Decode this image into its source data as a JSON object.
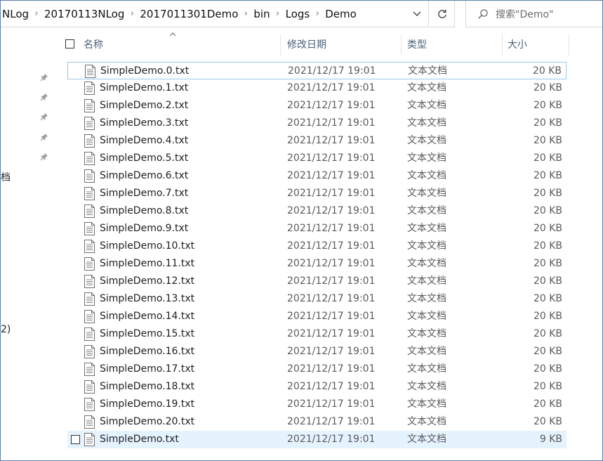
{
  "address": {
    "crumbs": [
      "NLog",
      "20170113NLog",
      "2017011301Demo",
      "bin",
      "Logs",
      "Demo"
    ]
  },
  "search": {
    "placeholder": "搜索\"Demo\""
  },
  "nav": {
    "fragments": [
      "档",
      "2)"
    ]
  },
  "columns": {
    "name": "名称",
    "date": "修改日期",
    "type": "类型",
    "size": "大小"
  },
  "files": [
    {
      "name": "SimpleDemo.0.txt",
      "date": "2021/12/17 19:01",
      "type": "文本文档",
      "size": "20 KB"
    },
    {
      "name": "SimpleDemo.1.txt",
      "date": "2021/12/17 19:01",
      "type": "文本文档",
      "size": "20 KB"
    },
    {
      "name": "SimpleDemo.2.txt",
      "date": "2021/12/17 19:01",
      "type": "文本文档",
      "size": "20 KB"
    },
    {
      "name": "SimpleDemo.3.txt",
      "date": "2021/12/17 19:01",
      "type": "文本文档",
      "size": "20 KB"
    },
    {
      "name": "SimpleDemo.4.txt",
      "date": "2021/12/17 19:01",
      "type": "文本文档",
      "size": "20 KB"
    },
    {
      "name": "SimpleDemo.5.txt",
      "date": "2021/12/17 19:01",
      "type": "文本文档",
      "size": "20 KB"
    },
    {
      "name": "SimpleDemo.6.txt",
      "date": "2021/12/17 19:01",
      "type": "文本文档",
      "size": "20 KB"
    },
    {
      "name": "SimpleDemo.7.txt",
      "date": "2021/12/17 19:01",
      "type": "文本文档",
      "size": "20 KB"
    },
    {
      "name": "SimpleDemo.8.txt",
      "date": "2021/12/17 19:01",
      "type": "文本文档",
      "size": "20 KB"
    },
    {
      "name": "SimpleDemo.9.txt",
      "date": "2021/12/17 19:01",
      "type": "文本文档",
      "size": "20 KB"
    },
    {
      "name": "SimpleDemo.10.txt",
      "date": "2021/12/17 19:01",
      "type": "文本文档",
      "size": "20 KB"
    },
    {
      "name": "SimpleDemo.11.txt",
      "date": "2021/12/17 19:01",
      "type": "文本文档",
      "size": "20 KB"
    },
    {
      "name": "SimpleDemo.12.txt",
      "date": "2021/12/17 19:01",
      "type": "文本文档",
      "size": "20 KB"
    },
    {
      "name": "SimpleDemo.13.txt",
      "date": "2021/12/17 19:01",
      "type": "文本文档",
      "size": "20 KB"
    },
    {
      "name": "SimpleDemo.14.txt",
      "date": "2021/12/17 19:01",
      "type": "文本文档",
      "size": "20 KB"
    },
    {
      "name": "SimpleDemo.15.txt",
      "date": "2021/12/17 19:01",
      "type": "文本文档",
      "size": "20 KB"
    },
    {
      "name": "SimpleDemo.16.txt",
      "date": "2021/12/17 19:01",
      "type": "文本文档",
      "size": "20 KB"
    },
    {
      "name": "SimpleDemo.17.txt",
      "date": "2021/12/17 19:01",
      "type": "文本文档",
      "size": "20 KB"
    },
    {
      "name": "SimpleDemo.18.txt",
      "date": "2021/12/17 19:01",
      "type": "文本文档",
      "size": "20 KB"
    },
    {
      "name": "SimpleDemo.19.txt",
      "date": "2021/12/17 19:01",
      "type": "文本文档",
      "size": "20 KB"
    },
    {
      "name": "SimpleDemo.20.txt",
      "date": "2021/12/17 19:01",
      "type": "文本文档",
      "size": "20 KB"
    },
    {
      "name": "SimpleDemo.txt",
      "date": "2021/12/17 19:01",
      "type": "文本文档",
      "size": "9 KB"
    }
  ],
  "colors": {
    "frame_border": "#5b7fa6",
    "header_text": "#4c607a",
    "hover_row": "#e5f3ff",
    "focus_border": "#99c9ef"
  }
}
